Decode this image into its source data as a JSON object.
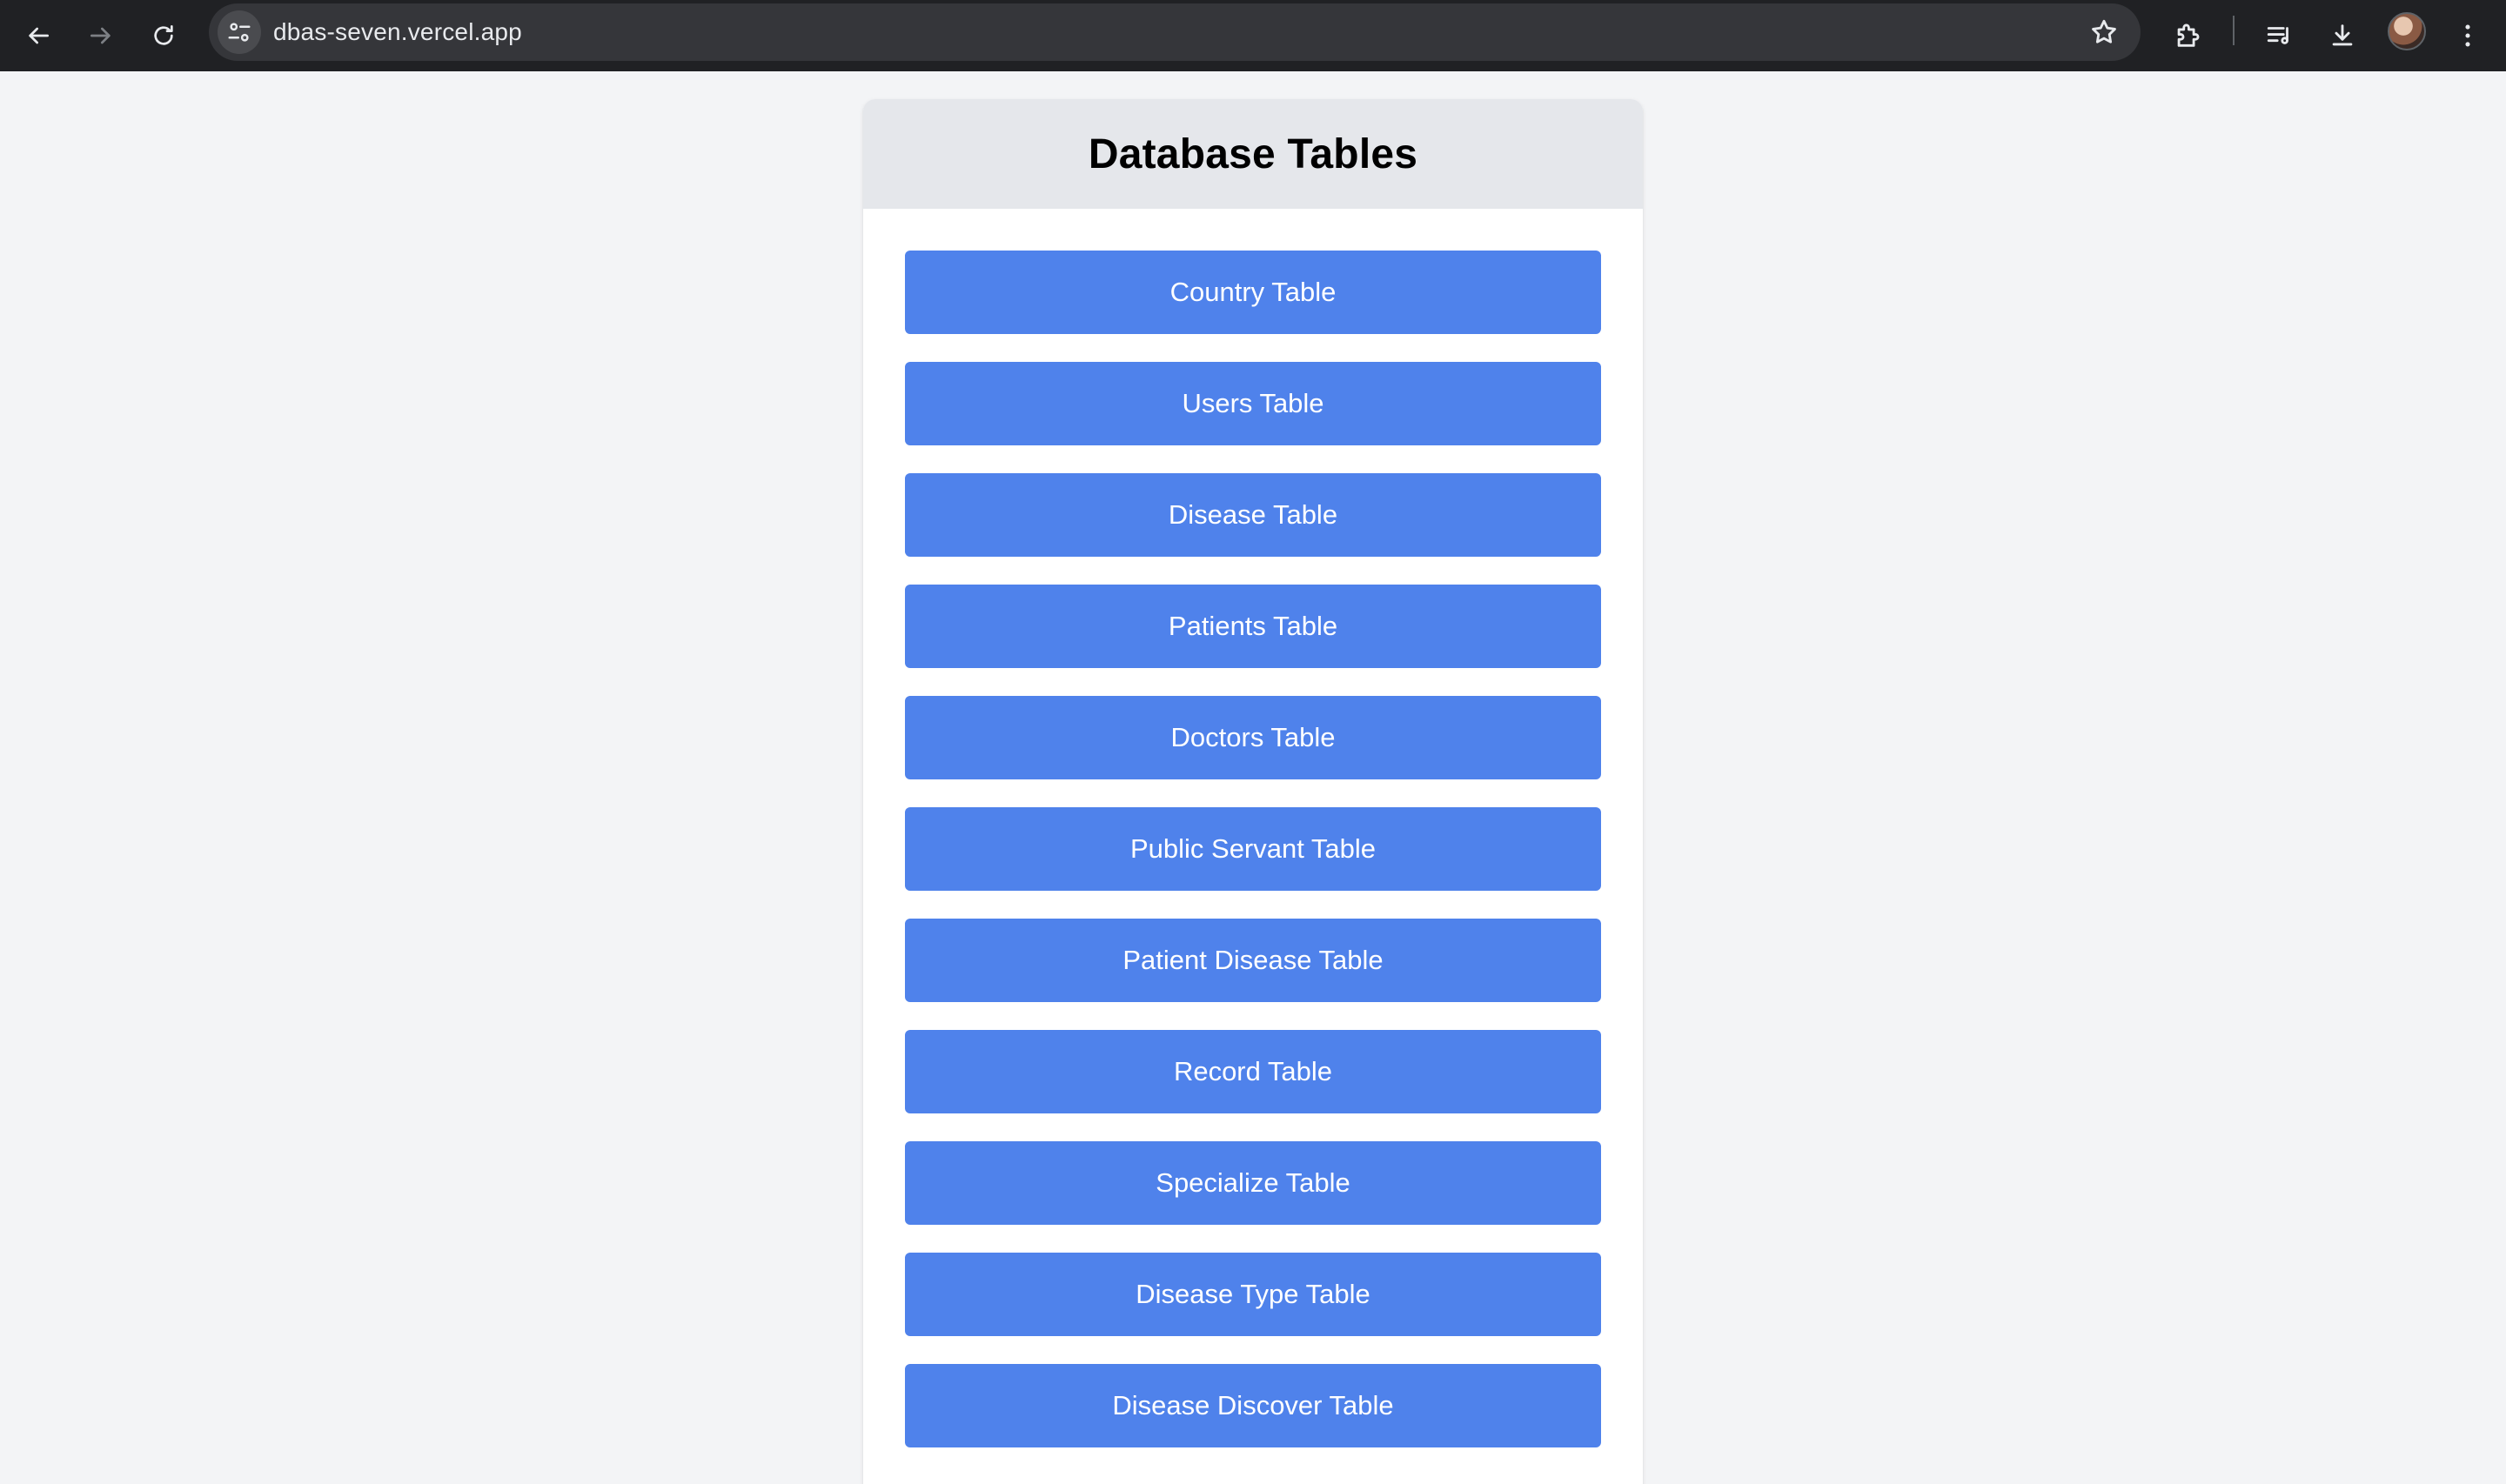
{
  "browser": {
    "url": "dbas-seven.vercel.app",
    "icons": {
      "back": "back-arrow-icon",
      "forward": "forward-arrow-icon",
      "reload": "reload-icon",
      "site_info": "site-settings-icon",
      "bookmark": "star-icon",
      "extensions": "puzzle-icon",
      "media": "media-queue-icon",
      "downloads": "download-icon",
      "menu": "three-dots-icon"
    }
  },
  "page": {
    "title": "Database Tables",
    "buttons": [
      {
        "label": "Country Table"
      },
      {
        "label": "Users Table"
      },
      {
        "label": "Disease Table"
      },
      {
        "label": "Patients Table"
      },
      {
        "label": "Doctors Table"
      },
      {
        "label": "Public Servant Table"
      },
      {
        "label": "Patient Disease Table"
      },
      {
        "label": "Record Table"
      },
      {
        "label": "Specialize Table"
      },
      {
        "label": "Disease Type Table"
      },
      {
        "label": "Disease Discover Table"
      }
    ]
  },
  "colors": {
    "button_bg": "#4f82eb",
    "header_bg": "#e5e7eb",
    "page_bg": "#f3f4f6",
    "chrome_bg": "#202124"
  }
}
